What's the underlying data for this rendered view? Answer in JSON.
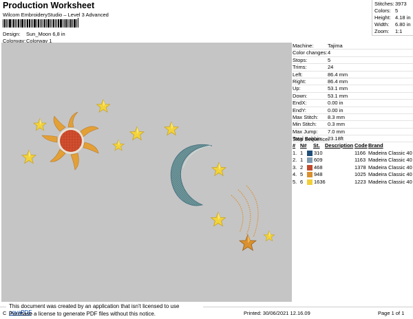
{
  "header": {
    "title": "Production Worksheet",
    "subtitle": "Wilcom EmbroideryStudio – Level 3 Advanced",
    "design_label": "Design:",
    "design_value": "Sun_Moon 6,8 in",
    "colorway_label": "Colorway:",
    "colorway_value": "Colorway 1"
  },
  "stats": [
    {
      "label": "Stitches:",
      "value": "3973"
    },
    {
      "label": "Colors:",
      "value": "5"
    },
    {
      "label": "Height:",
      "value": "4.18 in"
    },
    {
      "label": "Width:",
      "value": "6.80 in"
    },
    {
      "label": "Zoom:",
      "value": "1:1"
    }
  ],
  "info": [
    {
      "label": "Machine:",
      "value": "Tajima"
    },
    {
      "label": "Color changes:",
      "value": "4"
    },
    {
      "label": "Stops:",
      "value": "5"
    },
    {
      "label": "Trims:",
      "value": "24"
    },
    {
      "label": "Left:",
      "value": "86.4 mm"
    },
    {
      "label": "Right:",
      "value": "86.4 mm"
    },
    {
      "label": "Up:",
      "value": "53.1 mm"
    },
    {
      "label": "Down:",
      "value": "53.1 mm"
    },
    {
      "label": "EndX:",
      "value": "0.00 in"
    },
    {
      "label": "EndY:",
      "value": "0.00 in"
    },
    {
      "label": "Max Stitch:",
      "value": "8.3 mm"
    },
    {
      "label": "Min Stitch:",
      "value": "0.3 mm"
    },
    {
      "label": "Max Jump:",
      "value": "7.0 mm"
    },
    {
      "label": "Total Bobbin:",
      "value": "23.18ft"
    }
  ],
  "stop_sequence": {
    "title": "Stop Sequence:",
    "headers": [
      "#",
      "N#",
      "St.",
      "Description",
      "Code",
      "Brand"
    ],
    "rows": [
      {
        "idx": "1.",
        "n": "1",
        "color": "#1f4e7a",
        "st": "310",
        "code": "1166",
        "brand": "Madeira Classic 40"
      },
      {
        "idx": "2.",
        "n": "1",
        "color": "#7f9bb0",
        "st": "609",
        "code": "1163",
        "brand": "Madeira Classic 40"
      },
      {
        "idx": "3.",
        "n": "2",
        "color": "#c24a2c",
        "st": "468",
        "code": "1378",
        "brand": "Madeira Classic 40"
      },
      {
        "idx": "4.",
        "n": "5",
        "color": "#d9902e",
        "st": "948",
        "code": "1025",
        "brand": "Madeira Classic 40"
      },
      {
        "idx": "5.",
        "n": "6",
        "color": "#f1cf3a",
        "st": "1636",
        "code": "1223",
        "brand": "Madeira Classic 40"
      }
    ]
  },
  "notice": {
    "line1_text": "This document was created by an application that isn't licensed to use ",
    "line1_link": "novaPDF",
    "line1_end": ".",
    "line2": "Purchase a license to generate PDF files without this notice."
  },
  "footer": {
    "left": "Cr",
    "printed": "Printed: 30/06/2021 12.16.09",
    "page": "Page 1 of 1"
  },
  "colors": {
    "canvas": "#c5c5c5",
    "star_fill": "#f2d33b",
    "sun_center": "#d4512f",
    "sun_ray": "#e3a036",
    "moon_fill": "#6f95a8"
  }
}
